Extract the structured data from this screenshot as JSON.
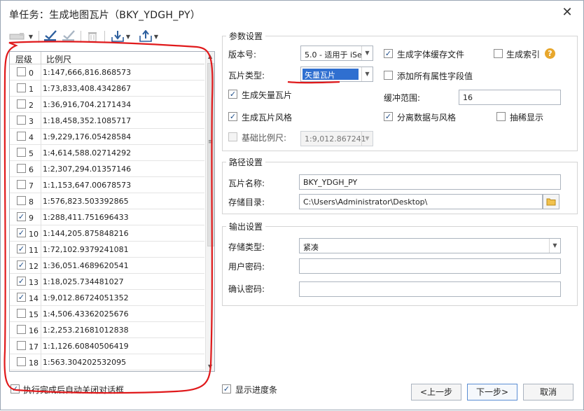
{
  "window": {
    "title": "单任务：生成地图瓦片（BKY_YDGH_PY）",
    "close_glyph": "✕"
  },
  "toolbar": {
    "icons": [
      "layers-dropdown-icon",
      "check-all-icon",
      "uncheck-all-icon",
      "delete-icon",
      "import-icon",
      "export-icon"
    ]
  },
  "levels": {
    "headers": [
      "层级",
      "比例尺"
    ],
    "rows": [
      {
        "level": "0",
        "scale": "1:147,666,816.868573",
        "checked": false
      },
      {
        "level": "1",
        "scale": "1:73,833,408.4342867",
        "checked": false
      },
      {
        "level": "2",
        "scale": "1:36,916,704.2171434",
        "checked": false
      },
      {
        "level": "3",
        "scale": "1:18,458,352.1085717",
        "checked": false
      },
      {
        "level": "4",
        "scale": "1:9,229,176.05428584",
        "checked": false
      },
      {
        "level": "5",
        "scale": "1:4,614,588.02714292",
        "checked": false
      },
      {
        "level": "6",
        "scale": "1:2,307,294.01357146",
        "checked": false
      },
      {
        "level": "7",
        "scale": "1:1,153,647.00678573",
        "checked": false
      },
      {
        "level": "8",
        "scale": "1:576,823.503392865",
        "checked": false
      },
      {
        "level": "9",
        "scale": "1:288,411.751696433",
        "checked": true
      },
      {
        "level": "10",
        "scale": "1:144,205.875848216",
        "checked": true
      },
      {
        "level": "11",
        "scale": "1:72,102.9379241081",
        "checked": true
      },
      {
        "level": "12",
        "scale": "1:36,051.4689620541",
        "checked": true
      },
      {
        "level": "13",
        "scale": "1:18,025.734481027",
        "checked": true
      },
      {
        "level": "14",
        "scale": "1:9,012.86724051352",
        "checked": true
      },
      {
        "level": "15",
        "scale": "1:4,506.43362025676",
        "checked": false
      },
      {
        "level": "16",
        "scale": "1:2,253.21681012838",
        "checked": false
      },
      {
        "level": "17",
        "scale": "1:1,126.60840506419",
        "checked": false
      },
      {
        "level": "18",
        "scale": "1:563.304202532095",
        "checked": false
      }
    ]
  },
  "params": {
    "group_title": "参数设置",
    "version_label": "版本号:",
    "version_value": "5.0 - 适用于 iSe",
    "tile_type_label": "瓦片类型:",
    "tile_type_value": "矢量瓦片",
    "gen_font_cache": "生成字体缓存文件",
    "gen_index": "生成索引",
    "add_all_attr": "添加所有属性字段值",
    "gen_vector_tiles": "生成矢量瓦片",
    "buffer_label": "缓冲范围:",
    "buffer_value": "16",
    "gen_tile_style": "生成瓦片风格",
    "split_data_style": "分离数据与风格",
    "sparse_display": "抽稀显示",
    "base_scale_label": "基础比例尺:",
    "base_scale_value": "1:9,012.867241"
  },
  "path": {
    "group_title": "路径设置",
    "tile_name_label": "瓦片名称:",
    "tile_name_value": "BKY_YDGH_PY",
    "dir_label": "存储目录:",
    "dir_value": "C:\\Users\\Administrator\\Desktop\\"
  },
  "output": {
    "group_title": "输出设置",
    "storage_type_label": "存储类型:",
    "storage_type_value": "紧凑",
    "user_pwd_label": "用户密码:",
    "user_pwd_value": "",
    "confirm_pwd_label": "确认密码:",
    "confirm_pwd_value": ""
  },
  "footer": {
    "auto_close": "执行完成后自动关闭对话框",
    "show_progress": "显示进度条",
    "prev": "<上一步",
    "next": "下一步>",
    "cancel": "取消"
  },
  "colors": {
    "annotation_red": "#e0191b",
    "selection_blue": "#2f6fd0",
    "check_blue": "#1f4e8a"
  }
}
